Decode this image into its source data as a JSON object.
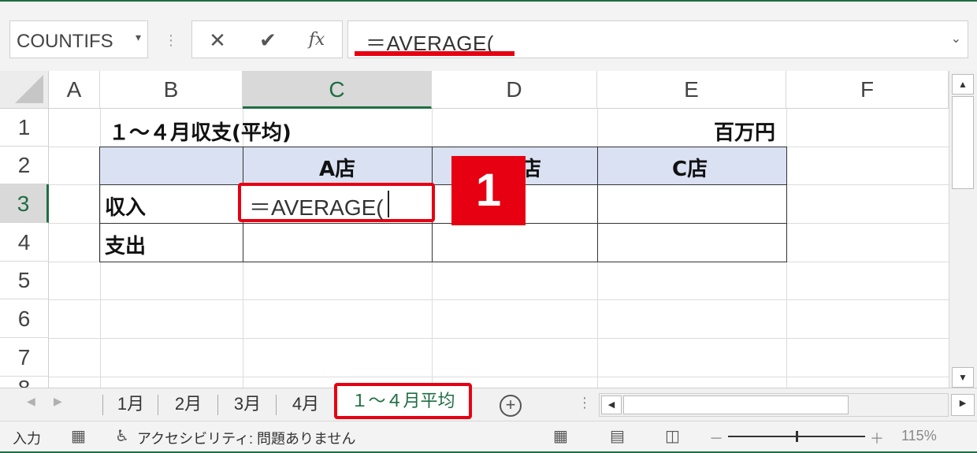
{
  "formula_bar": {
    "name_box": "COUNTIFS",
    "cancel_icon": "✕",
    "enter_icon": "✔",
    "function_icon": "fx",
    "formula": "＝AVERAGE("
  },
  "columns": [
    "A",
    "B",
    "C",
    "D",
    "E",
    "F"
  ],
  "active_column": "C",
  "rows": [
    "1",
    "2",
    "3",
    "4",
    "5",
    "6",
    "7",
    "8"
  ],
  "active_row": "3",
  "cells": {
    "B1": "１～４月収支(平均)",
    "E1": "百万円",
    "C2": "A店",
    "D2": "店",
    "E2": "C店",
    "B3": "収入",
    "C3": "＝AVERAGE(",
    "B4": "支出"
  },
  "callout_badge": "1",
  "sheet_tabs": [
    "1月",
    "2月",
    "3月",
    "4月",
    "１～４月平均"
  ],
  "active_sheet": "１～４月平均",
  "add_sheet_icon": "+",
  "status_bar": {
    "mode": "入力",
    "accessibility": "アクセシビリティ: 問題ありません",
    "zoom_minus": "－",
    "zoom_plus": "＋",
    "zoom": "115%"
  },
  "colors": {
    "accent_green": "#1e6e42",
    "highlight_red": "#e60012",
    "header_fill": "#d9e1f2"
  }
}
